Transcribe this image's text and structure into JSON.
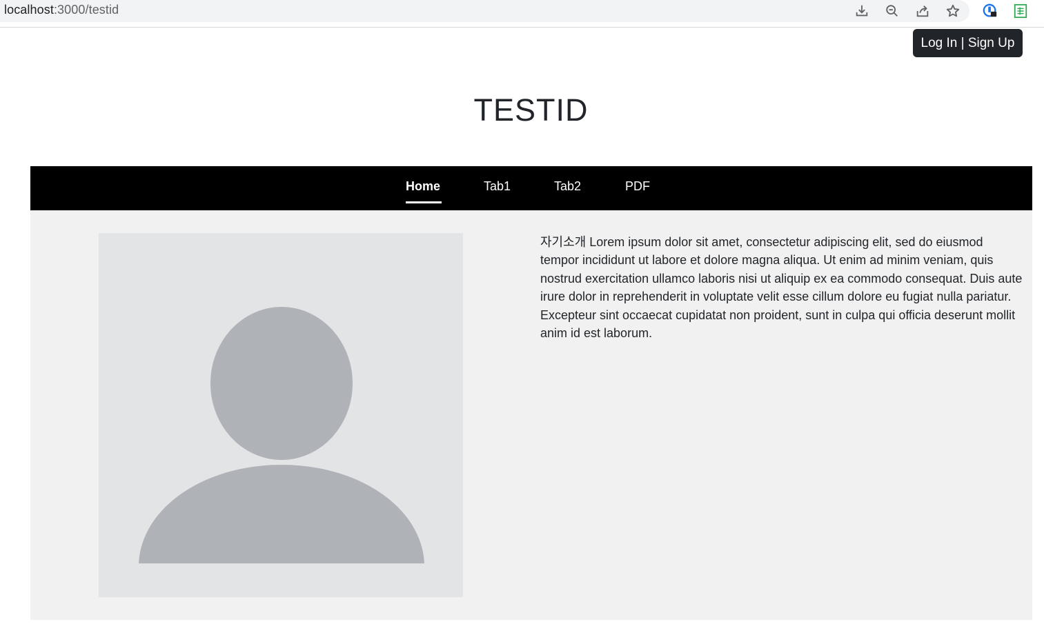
{
  "browser": {
    "url_host": "localhost",
    "url_path": ":3000/testid",
    "icons": [
      "download-icon",
      "zoom-out-icon",
      "share-icon",
      "star-icon",
      "extension-lock-icon",
      "sheets-extension-icon"
    ]
  },
  "auth": {
    "button_label": "Log In | Sign Up"
  },
  "page": {
    "title": "TESTID"
  },
  "nav": {
    "items": [
      {
        "label": "Home",
        "active": true
      },
      {
        "label": "Tab1",
        "active": false
      },
      {
        "label": "Tab2",
        "active": false
      },
      {
        "label": "PDF",
        "active": false
      }
    ]
  },
  "profile": {
    "avatar": "person-placeholder-icon",
    "bio": "자기소개 Lorem ipsum dolor sit amet, consectetur adipiscing elit, sed do eiusmod tempor incididunt ut labore et dolore magna aliqua. Ut enim ad minim veniam, quis nostrud exercitation ullamco laboris nisi ut aliquip ex ea commodo consequat. Duis aute irure dolor in reprehenderit in voluptate velit esse cillum dolore eu fugiat nulla pariatur. Excepteur sint occaecat cupidatat non proident, sunt in culpa qui officia deserunt mollit anim id est laborum."
  },
  "colors": {
    "nav_bg": "#000000",
    "content_bg": "#f1f1f1",
    "avatar_bg": "#e2e4e6",
    "avatar_fg": "#afb3b7",
    "button_bg": "#212529"
  }
}
